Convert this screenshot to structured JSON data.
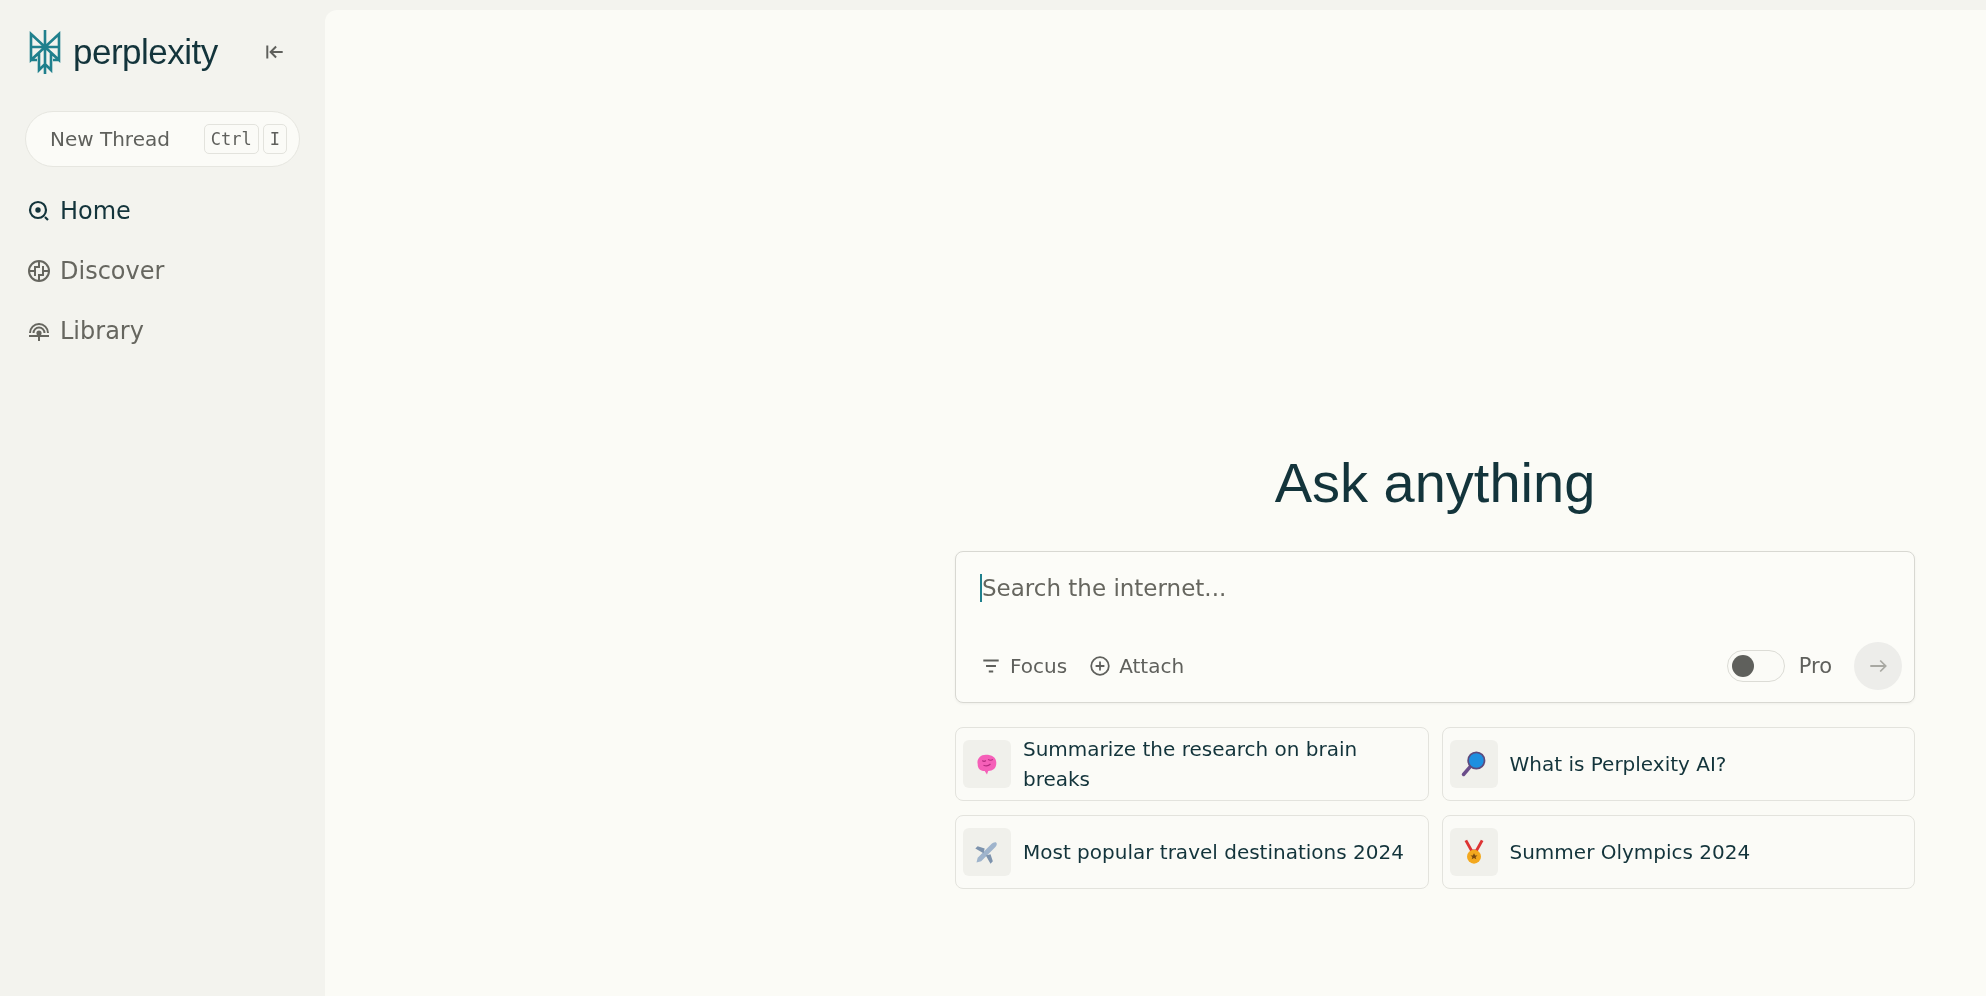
{
  "sidebar": {
    "brand": "perplexity",
    "new_thread": {
      "label": "New Thread",
      "keys": [
        "Ctrl",
        "I"
      ]
    },
    "items": [
      {
        "label": "Home",
        "kind": "home",
        "selected": true
      },
      {
        "label": "Discover",
        "kind": "discover",
        "selected": false
      },
      {
        "label": "Library",
        "kind": "library",
        "selected": false
      }
    ]
  },
  "main": {
    "title": "Ask anything",
    "search": {
      "placeholder": "Search the internet..."
    },
    "tools": [
      {
        "label": "Focus",
        "kind": "focus"
      },
      {
        "label": "Attach",
        "kind": "attach"
      }
    ],
    "pro": {
      "label": "Pro",
      "on": false
    },
    "suggestions": [
      {
        "label": "Summarize the research on brain breaks",
        "kind": "brain"
      },
      {
        "label": "What is Perplexity AI?",
        "kind": "magnifier"
      },
      {
        "label": "Most popular travel destinations 2024",
        "kind": "airplane"
      },
      {
        "label": "Summer Olympics 2024",
        "kind": "medal"
      }
    ]
  }
}
